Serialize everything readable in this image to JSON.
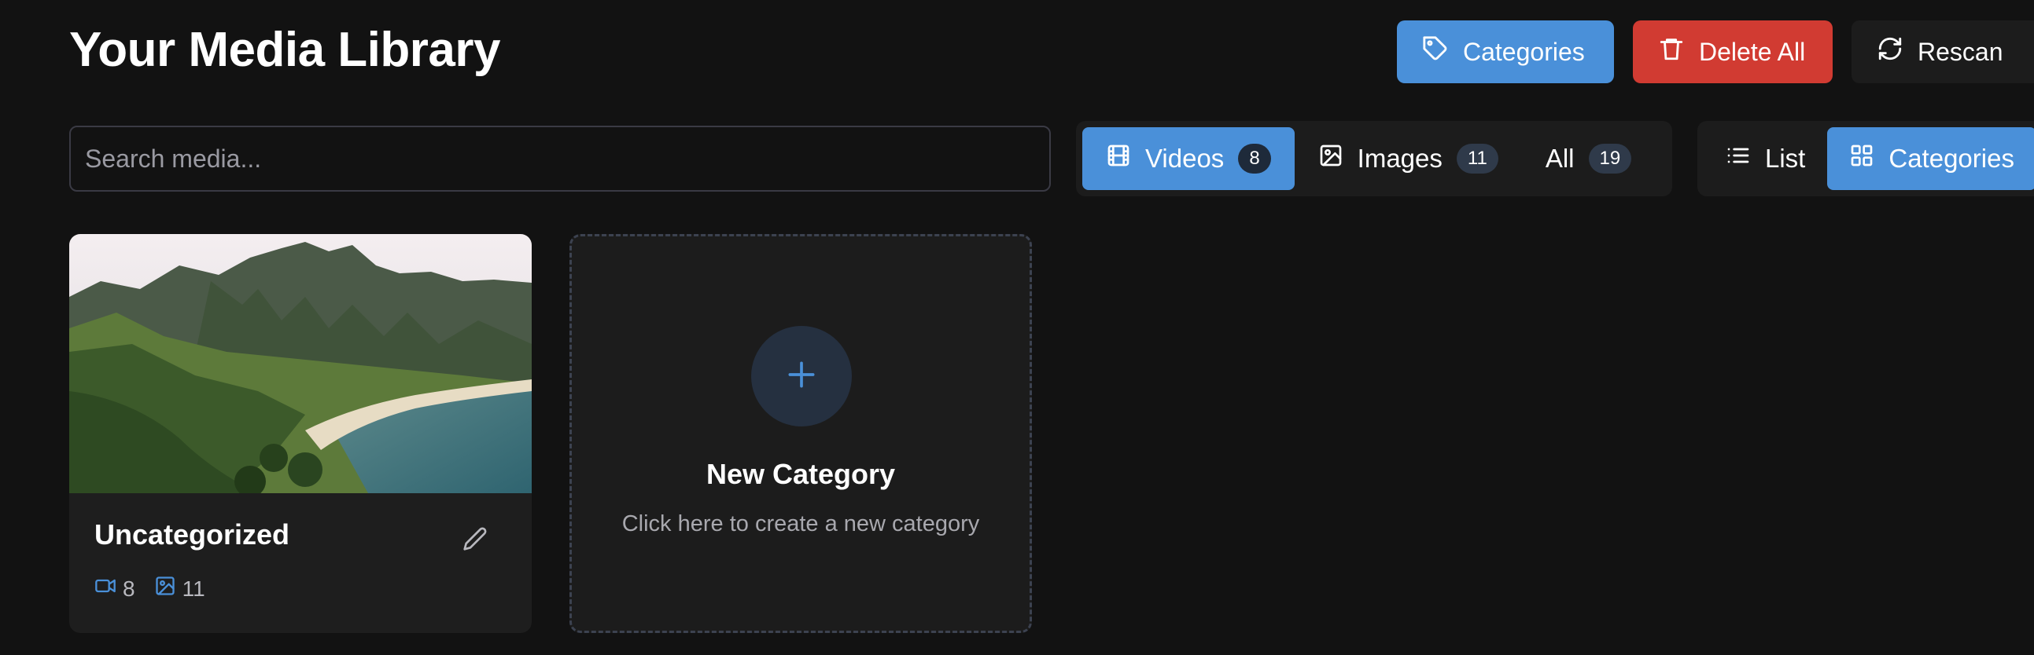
{
  "header": {
    "title": "Your Media Library",
    "actions": {
      "categories_label": "Categories",
      "delete_all_label": "Delete All",
      "rescan_label": "Rescan"
    }
  },
  "search": {
    "placeholder": "Search media...",
    "value": ""
  },
  "filters": [
    {
      "label": "Videos",
      "count": "8",
      "icon": "film-icon",
      "active": true
    },
    {
      "label": "Images",
      "count": "11",
      "icon": "image-icon",
      "active": false
    },
    {
      "label": "All",
      "count": "19",
      "icon": "",
      "active": false
    }
  ],
  "view_modes": [
    {
      "label": "List",
      "icon": "list-icon",
      "active": false
    },
    {
      "label": "Categories",
      "icon": "grid-icon",
      "active": true
    }
  ],
  "categories": [
    {
      "name": "Uncategorized",
      "video_count": "8",
      "image_count": "11",
      "thumbnail": "mountain-coastline-landscape"
    }
  ],
  "new_category": {
    "title": "New Category",
    "subtitle": "Click here to create a new category"
  },
  "colors": {
    "background": "#121212",
    "accent": "#4a90d9",
    "danger": "#d13b32",
    "surface": "#1c1c1c"
  }
}
